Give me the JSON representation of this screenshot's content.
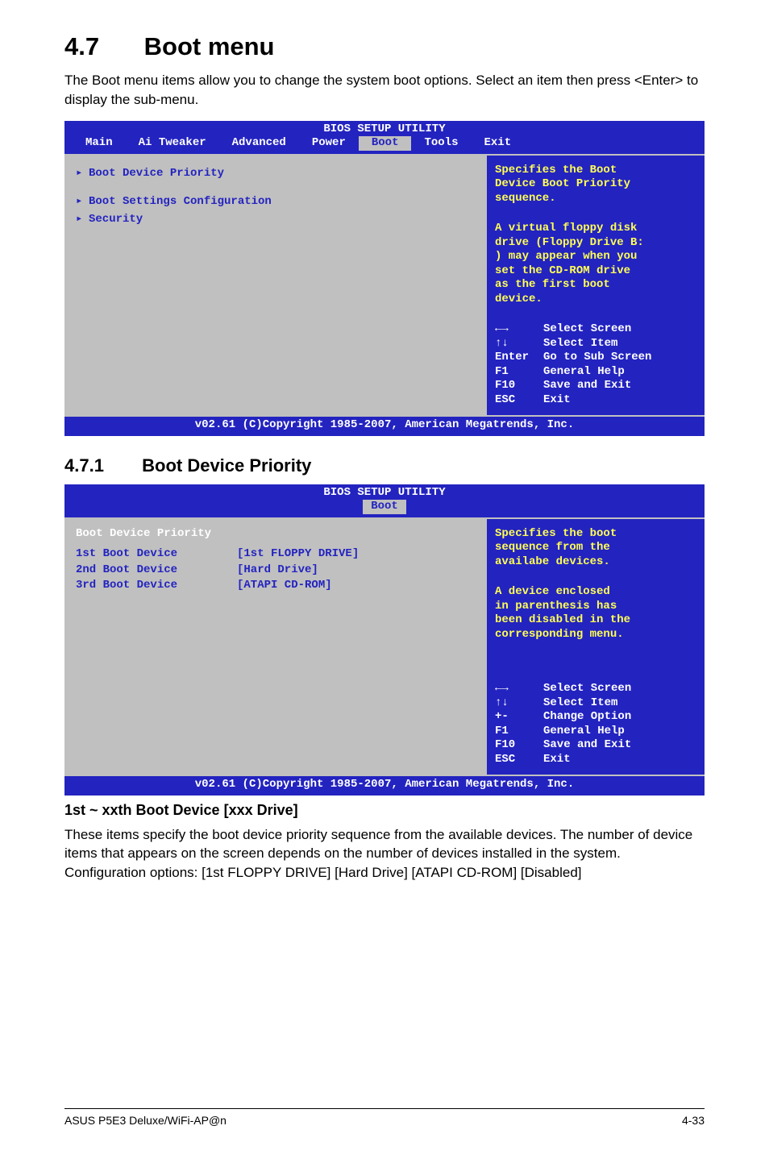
{
  "section": {
    "number": "4.7",
    "title": "Boot menu",
    "intro": "The Boot menu items allow you to change the system boot options. Select an item then press <Enter> to display the sub-menu."
  },
  "bios1": {
    "title": "BIOS SETUP UTILITY",
    "tabs": [
      "Main",
      "Ai Tweaker",
      "Advanced",
      "Power",
      "Boot",
      "Tools",
      "Exit"
    ],
    "selected_tab": "Boot",
    "left_items": [
      "Boot Device Priority",
      "Boot Settings Configuration",
      "Security"
    ],
    "help_lines": [
      "Specifies the Boot",
      "Device Boot Priority",
      "sequence."
    ],
    "help_lines2": [
      "A virtual floppy disk",
      "drive (Floppy Drive B:",
      ") may appear when you",
      "set the CD-ROM drive",
      "as the first boot",
      "device."
    ],
    "legend": [
      {
        "key": "←→",
        "val": "Select Screen",
        "white": true
      },
      {
        "key": "↑↓",
        "val": "Select Item",
        "white": true
      },
      {
        "key": "Enter",
        "val": "Go to Sub Screen",
        "white": true
      },
      {
        "key": "F1",
        "val": "General Help",
        "white": true
      },
      {
        "key": "F10",
        "val": "Save and Exit",
        "white": true
      },
      {
        "key": "ESC",
        "val": "Exit",
        "white": true
      }
    ],
    "footer": "v02.61 (C)Copyright 1985-2007, American Megatrends, Inc."
  },
  "subsection": {
    "number": "4.7.1",
    "title": "Boot Device Priority"
  },
  "bios2": {
    "title": "BIOS SETUP UTILITY",
    "tab": "Boot",
    "panel_title": "Boot Device Priority",
    "rows": [
      {
        "k": "1st Boot Device",
        "v": "[1st FLOPPY DRIVE]"
      },
      {
        "k": "2nd Boot Device",
        "v": "[Hard Drive]"
      },
      {
        "k": "3rd Boot Device",
        "v": "[ATAPI CD-ROM]"
      }
    ],
    "help_lines": [
      "Specifies the boot",
      "sequence from the",
      "availabe devices."
    ],
    "help_lines2": [
      "A device enclosed",
      "in parenthesis has",
      "been disabled in the",
      "corresponding menu."
    ],
    "legend": [
      {
        "key": "←→",
        "val": "Select Screen"
      },
      {
        "key": "↑↓",
        "val": "Select Item"
      },
      {
        "key": "+-",
        "val": "Change Option"
      },
      {
        "key": "F1",
        "val": "General Help"
      },
      {
        "key": "F10",
        "val": "Save and Exit"
      },
      {
        "key": "ESC",
        "val": "Exit"
      }
    ],
    "footer": "v02.61 (C)Copyright 1985-2007, American Megatrends, Inc."
  },
  "sub_heading": "1st ~ xxth Boot Device [xxx Drive]",
  "sub_body": "These items specify the boot device priority sequence from the available devices. The number of device items that appears on the screen depends on the number of devices installed in the system. Configuration options: [1st FLOPPY DRIVE] [Hard Drive] [ATAPI CD-ROM] [Disabled]",
  "page_footer_left": "ASUS P5E3 Deluxe/WiFi-AP@n",
  "page_footer_right": "4-33"
}
